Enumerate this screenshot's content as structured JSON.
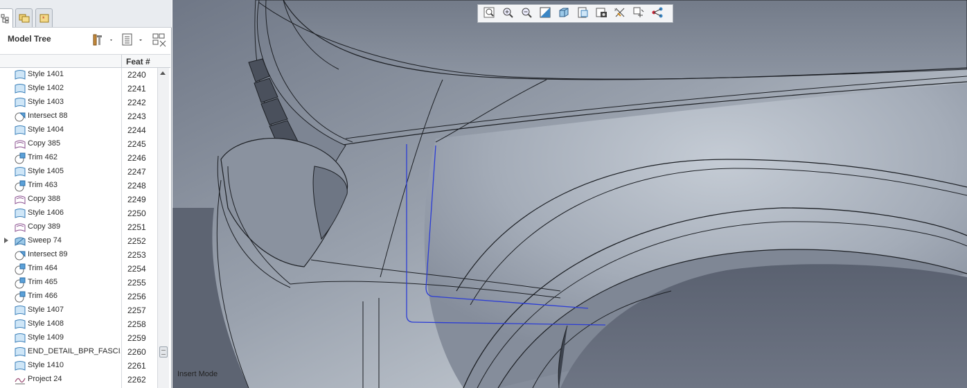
{
  "panel": {
    "title": "Model Tree",
    "column_feat": "Feat #",
    "nav_tabs": [
      "model-tree-icon",
      "folder-browser-icon",
      "favorites-icon"
    ]
  },
  "tree": {
    "rows": [
      {
        "name": "Style 1401",
        "feat": "2240",
        "icon": "style"
      },
      {
        "name": "Style 1402",
        "feat": "2241",
        "icon": "style"
      },
      {
        "name": "Style 1403",
        "feat": "2242",
        "icon": "style"
      },
      {
        "name": "Intersect 88",
        "feat": "2243",
        "icon": "intersect"
      },
      {
        "name": "Style 1404",
        "feat": "2244",
        "icon": "style"
      },
      {
        "name": "Copy 385",
        "feat": "2245",
        "icon": "copy"
      },
      {
        "name": "Trim 462",
        "feat": "2246",
        "icon": "trim"
      },
      {
        "name": "Style 1405",
        "feat": "2247",
        "icon": "style"
      },
      {
        "name": "Trim 463",
        "feat": "2248",
        "icon": "trim"
      },
      {
        "name": "Copy 388",
        "feat": "2249",
        "icon": "copy"
      },
      {
        "name": "Style 1406",
        "feat": "2250",
        "icon": "style"
      },
      {
        "name": "Copy 389",
        "feat": "2251",
        "icon": "copy"
      },
      {
        "name": "Sweep 74",
        "feat": "2252",
        "icon": "sweep",
        "expandable": true
      },
      {
        "name": "Intersect 89",
        "feat": "2253",
        "icon": "intersect"
      },
      {
        "name": "Trim 464",
        "feat": "2254",
        "icon": "trim"
      },
      {
        "name": "Trim 465",
        "feat": "2255",
        "icon": "trim"
      },
      {
        "name": "Trim 466",
        "feat": "2256",
        "icon": "trim"
      },
      {
        "name": "Style 1407",
        "feat": "2257",
        "icon": "style"
      },
      {
        "name": "Style 1408",
        "feat": "2258",
        "icon": "style"
      },
      {
        "name": "Style 1409",
        "feat": "2259",
        "icon": "style"
      },
      {
        "name": "END_DETAIL_BPR_FASCIA",
        "feat": "2260",
        "icon": "style"
      },
      {
        "name": "Style 1410",
        "feat": "2261",
        "icon": "style"
      },
      {
        "name": "Project 24",
        "feat": "2262",
        "icon": "project"
      }
    ]
  },
  "toolbar": {
    "buttons": [
      "refit-icon",
      "zoom-in-icon",
      "zoom-out-icon",
      "repaint-icon",
      "display-style-icon",
      "saved-views-icon",
      "view-manager-icon",
      "datum-display-icon",
      "spin-center-icon",
      "annotation-display-icon"
    ]
  },
  "status": {
    "mode": "Insert Mode"
  }
}
